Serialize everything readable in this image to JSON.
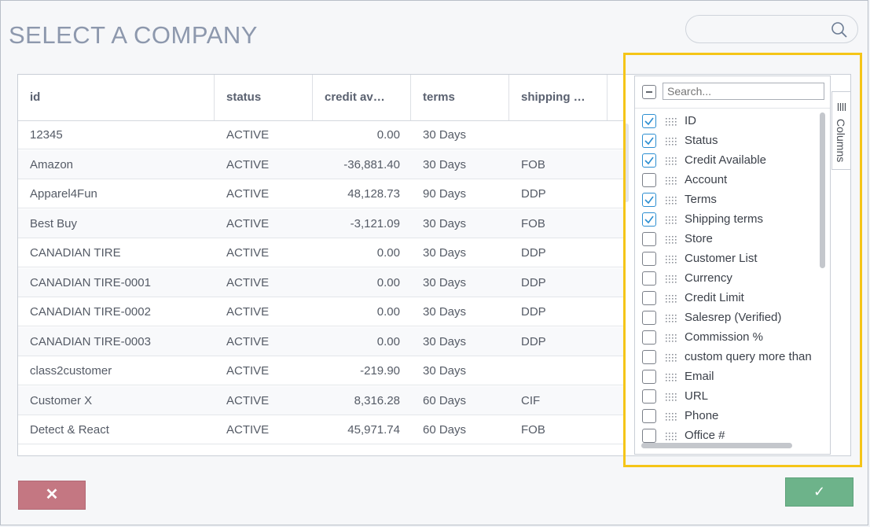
{
  "title": "SELECT A COMPANY",
  "search": {
    "placeholder": ""
  },
  "grid": {
    "headers": [
      "id",
      "status",
      "credit av…",
      "terms",
      "shipping …"
    ],
    "rows": [
      {
        "id": "12345",
        "status": "ACTIVE",
        "credit": "0.00",
        "terms": "30 Days",
        "shipping": ""
      },
      {
        "id": "Amazon",
        "status": "ACTIVE",
        "credit": "-36,881.40",
        "terms": "30 Days",
        "shipping": "FOB"
      },
      {
        "id": "Apparel4Fun",
        "status": "ACTIVE",
        "credit": "48,128.73",
        "terms": "90 Days",
        "shipping": "DDP"
      },
      {
        "id": "Best Buy",
        "status": "ACTIVE",
        "credit": "-3,121.09",
        "terms": "30 Days",
        "shipping": "FOB"
      },
      {
        "id": "CANADIAN TIRE",
        "status": "ACTIVE",
        "credit": "0.00",
        "terms": "30 Days",
        "shipping": "DDP"
      },
      {
        "id": "CANADIAN TIRE-0001",
        "status": "ACTIVE",
        "credit": "0.00",
        "terms": "30 Days",
        "shipping": "DDP"
      },
      {
        "id": "CANADIAN TIRE-0002",
        "status": "ACTIVE",
        "credit": "0.00",
        "terms": "30 Days",
        "shipping": "DDP"
      },
      {
        "id": "CANADIAN TIRE-0003",
        "status": "ACTIVE",
        "credit": "0.00",
        "terms": "30 Days",
        "shipping": "DDP"
      },
      {
        "id": "class2customer",
        "status": "ACTIVE",
        "credit": "-219.90",
        "terms": "30 Days",
        "shipping": ""
      },
      {
        "id": "Customer X",
        "status": "ACTIVE",
        "credit": "8,316.28",
        "terms": "60 Days",
        "shipping": "CIF"
      },
      {
        "id": "Detect & React",
        "status": "ACTIVE",
        "credit": "45,971.74",
        "terms": "60 Days",
        "shipping": "FOB"
      }
    ]
  },
  "columns_panel": {
    "tab_label": "Columns",
    "search_placeholder": "Search...",
    "select_all_state": "indeterminate",
    "items": [
      {
        "label": "ID",
        "checked": true
      },
      {
        "label": "Status",
        "checked": true
      },
      {
        "label": "Credit Available",
        "checked": true
      },
      {
        "label": "Account",
        "checked": false
      },
      {
        "label": "Terms",
        "checked": true
      },
      {
        "label": "Shipping terms",
        "checked": true
      },
      {
        "label": "Store",
        "checked": false
      },
      {
        "label": "Customer List",
        "checked": false
      },
      {
        "label": "Currency",
        "checked": false
      },
      {
        "label": "Credit Limit",
        "checked": false
      },
      {
        "label": "Salesrep (Verified)",
        "checked": false
      },
      {
        "label": "Commission %",
        "checked": false
      },
      {
        "label": "custom query more than",
        "checked": false
      },
      {
        "label": "Email",
        "checked": false
      },
      {
        "label": "URL",
        "checked": false
      },
      {
        "label": "Phone",
        "checked": false
      },
      {
        "label": "Office #",
        "checked": false
      }
    ]
  },
  "buttons": {
    "cancel": "✕",
    "confirm": "✓"
  },
  "colors": {
    "highlight": "#f5c518",
    "cancel": "#c47782",
    "confirm": "#6db38a",
    "check": "#2d8fd1"
  }
}
